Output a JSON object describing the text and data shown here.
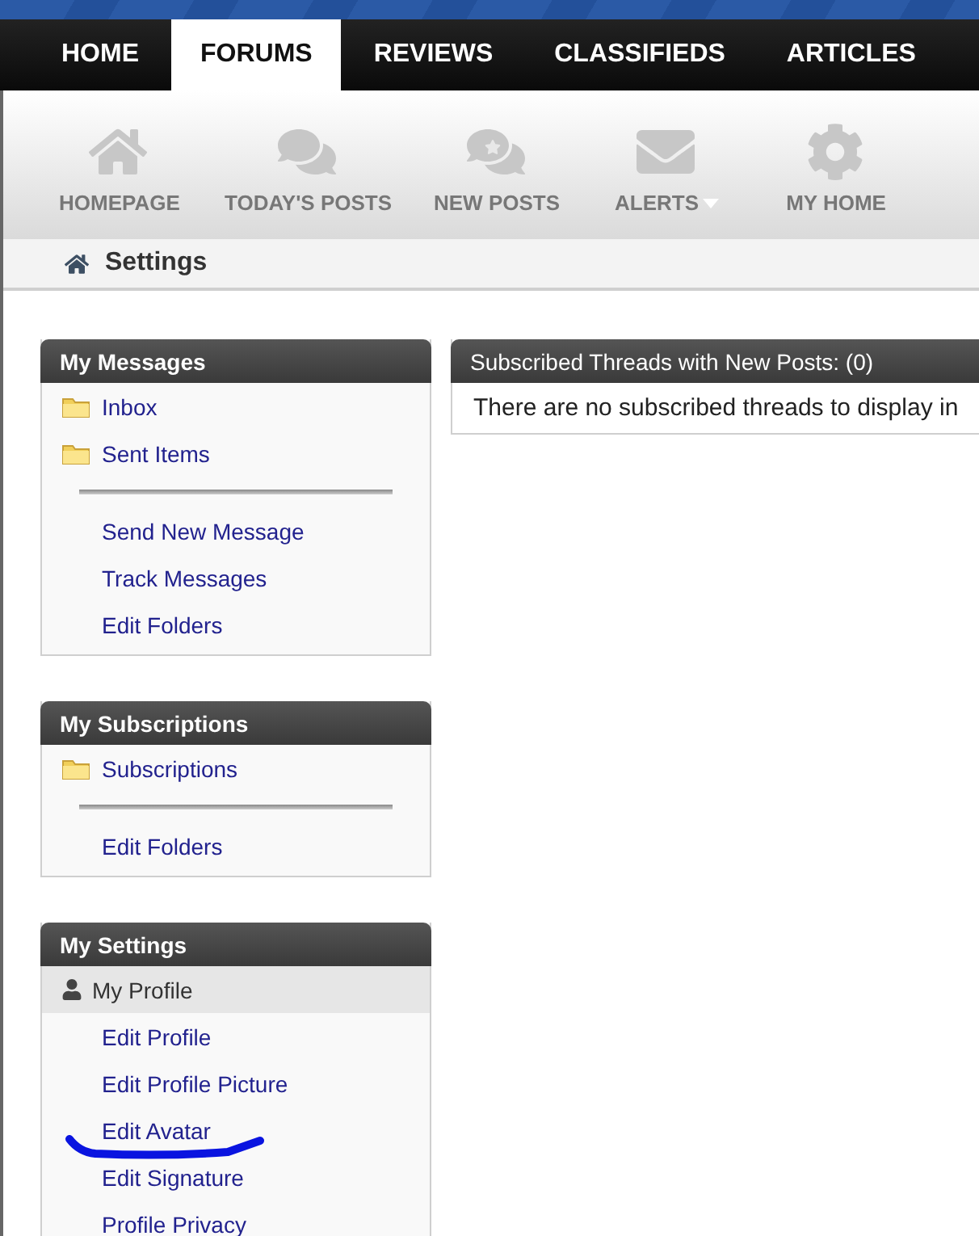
{
  "nav": {
    "tabs": [
      {
        "label": "HOME",
        "selected": false
      },
      {
        "label": "FORUMS",
        "selected": true
      },
      {
        "label": "REVIEWS",
        "selected": false
      },
      {
        "label": "CLASSIFIEDS",
        "selected": false
      },
      {
        "label": "ARTICLES",
        "selected": false
      }
    ]
  },
  "toolbar": {
    "items": [
      {
        "label": "HOMEPAGE",
        "has_menu": false
      },
      {
        "label": "TODAY'S POSTS",
        "has_menu": false
      },
      {
        "label": "NEW POSTS",
        "has_menu": false
      },
      {
        "label": "ALERTS",
        "has_menu": true
      },
      {
        "label": "MY HOME",
        "has_menu": false
      }
    ]
  },
  "breadcrumb": {
    "label": "Settings"
  },
  "sidebar": [
    {
      "title": "My Messages",
      "items": [
        {
          "kind": "folder",
          "label": "Inbox"
        },
        {
          "kind": "divider_before_links",
          "label": "Sent Items"
        },
        {
          "kind": "link",
          "label": "Send New Message"
        },
        {
          "kind": "link",
          "label": "Track Messages"
        },
        {
          "kind": "link",
          "label": "Edit Folders"
        }
      ]
    },
    {
      "title": "My Subscriptions",
      "items": [
        {
          "kind": "divider_before_links",
          "label": "Subscriptions"
        },
        {
          "kind": "link",
          "label": "Edit Folders"
        }
      ]
    },
    {
      "title": "My Settings",
      "items": [
        {
          "kind": "section",
          "label": "My Profile"
        },
        {
          "kind": "link",
          "label": "Edit Profile"
        },
        {
          "kind": "link",
          "label": "Edit Profile Picture"
        },
        {
          "kind": "link",
          "label": "Edit Avatar",
          "marked": true
        },
        {
          "kind": "link",
          "label": "Edit Signature"
        },
        {
          "kind": "link",
          "label": "Profile Privacy"
        }
      ]
    }
  ],
  "main": {
    "title": "Subscribed Threads with New Posts: (0)",
    "message": "There are no subscribed threads to display in"
  }
}
